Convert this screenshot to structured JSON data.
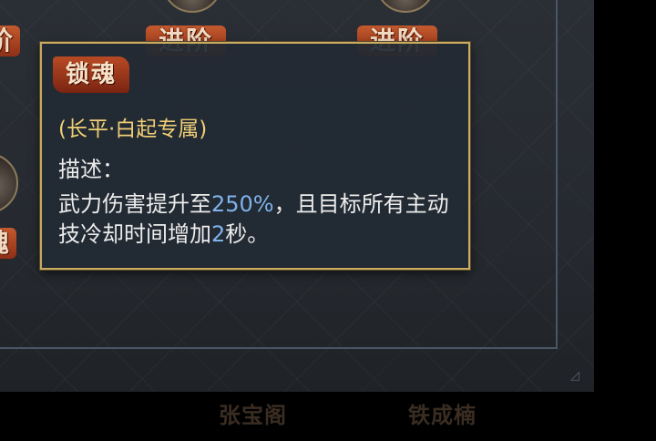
{
  "background": {
    "banner_top_left": "阶",
    "banner_top_1": "进阶",
    "banner_top_2": "进阶",
    "banner_mid_left": "魂",
    "bottom_name_1": "张宝阁",
    "bottom_name_2": "铁成楠"
  },
  "tooltip": {
    "title": "锁魂",
    "subtitle": "(长平·白起专属)",
    "label": "描述：",
    "desc_part1": "武力伤害提升至",
    "desc_value1": "250%",
    "desc_part2": "，且目标所有主动技冷却时间增加",
    "desc_value2": "2",
    "desc_part3": "秒。"
  },
  "colors": {
    "title_banner": "#a03a1c",
    "subtitle": "#f0cf76",
    "highlight": "#7fb2ea",
    "border": "#c8aa60"
  }
}
